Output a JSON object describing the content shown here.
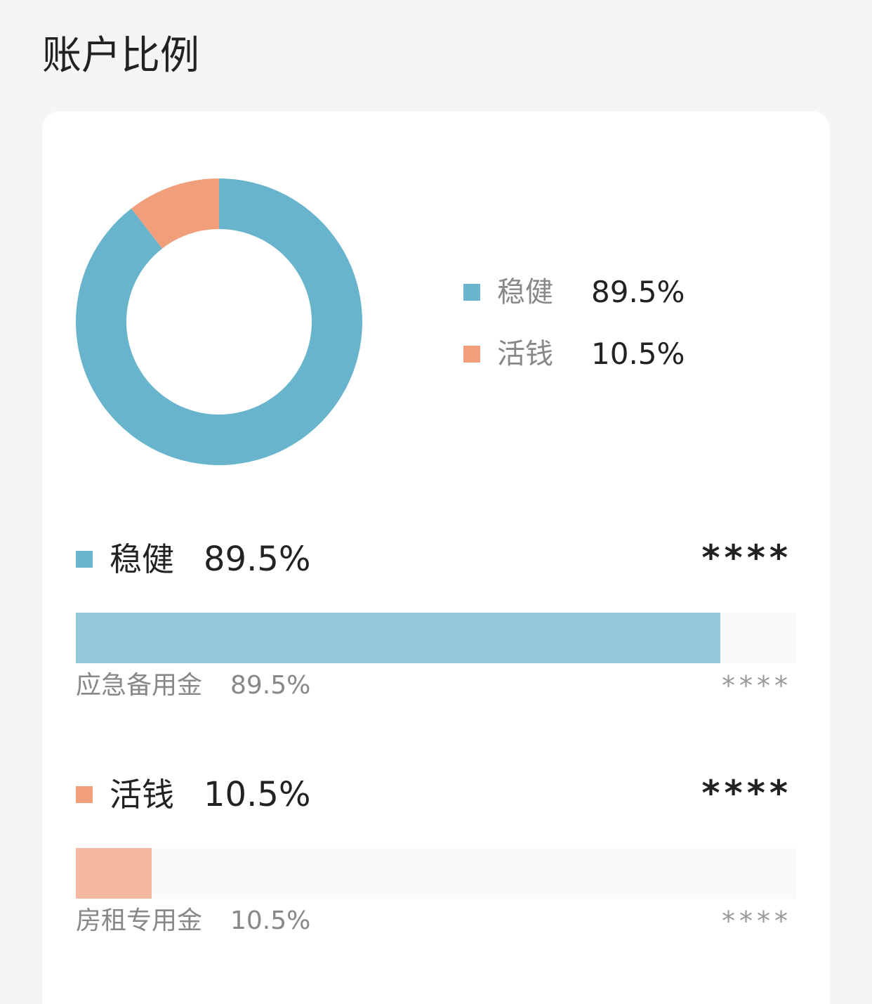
{
  "page": {
    "title": "账户比例"
  },
  "colors": {
    "stable": "#68b4cd",
    "stable_bar": "#93c9d8",
    "liquid": "#f19e7b",
    "liquid_bar": "#f4b9a0"
  },
  "legend": [
    {
      "label": "稳健",
      "value": "89.5%"
    },
    {
      "label": "活钱",
      "value": "10.5%"
    }
  ],
  "chart_data": {
    "type": "pie",
    "categories": [
      "稳健",
      "活钱"
    ],
    "values": [
      89.5,
      10.5
    ]
  },
  "categories": [
    {
      "name": "稳健",
      "percent": "89.5%",
      "amount": "****",
      "sub": {
        "name": "应急备用金",
        "percent": "89.5%",
        "amount": "****",
        "fraction": 0.895
      }
    },
    {
      "name": "活钱",
      "percent": "10.5%",
      "amount": "****",
      "sub": {
        "name": "房租专用金",
        "percent": "10.5%",
        "amount": "****",
        "fraction": 0.105
      }
    }
  ]
}
